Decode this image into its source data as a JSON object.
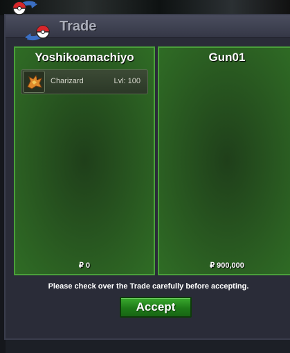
{
  "window": {
    "title": "Trade"
  },
  "left_panel": {
    "player_name": "Yoshikoamachiyo",
    "items": [
      {
        "name": "Charizard",
        "level": "Lvl: 100",
        "icon": "charizard-sprite-icon"
      }
    ],
    "money": "₽ 0"
  },
  "right_panel": {
    "player_name": "Gun01",
    "items": [],
    "money": "₽ 900,000"
  },
  "notice": "Please check over the Trade carefully before accepting.",
  "accept_label": "Accept",
  "colors": {
    "panel_green": "#2b5f22",
    "panel_border": "#4aa03a",
    "button_green": "#1e7a18",
    "window_bg": "#2a2c38"
  }
}
